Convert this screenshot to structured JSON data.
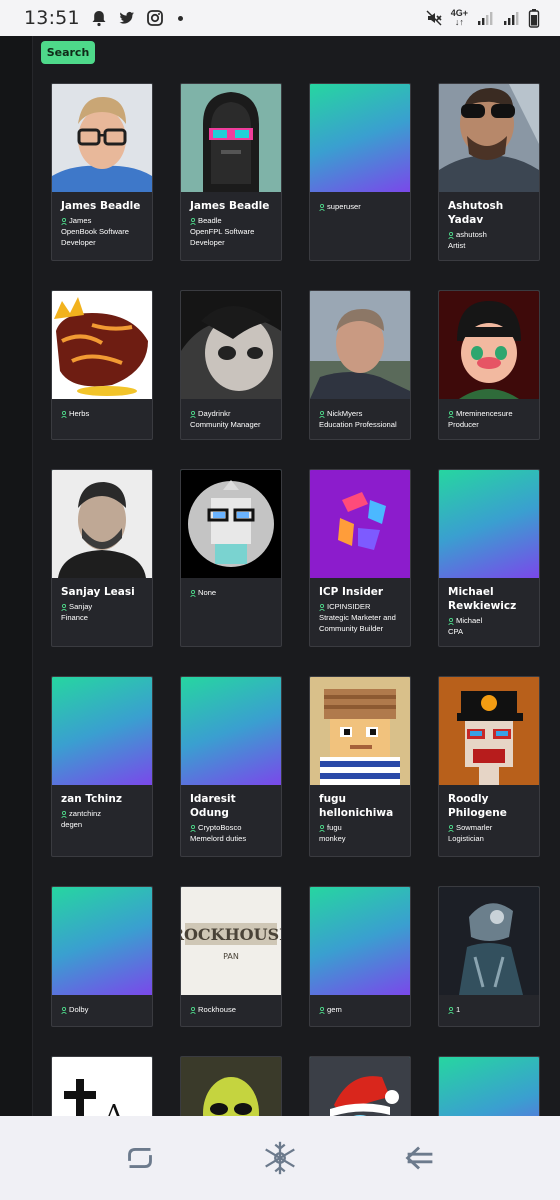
{
  "status_bar": {
    "time": "13:51",
    "icons": [
      "notification-bell-icon",
      "twitter-icon",
      "instagram-icon",
      "dot-icon",
      "mute-icon",
      "network-4g-icon",
      "signal-icon",
      "signal-icon",
      "battery-icon"
    ],
    "network": "4G+"
  },
  "search": {
    "label": "Search"
  },
  "cards": [
    {
      "name": "James Beadle",
      "handle": "James",
      "bio": "OpenBook Software Developer",
      "avatar": "photo-man-glasses"
    },
    {
      "name": "James Beadle",
      "handle": "Beadle",
      "bio": "OpenFPL Software Developer",
      "avatar": "pixel-hooded-figure"
    },
    {
      "name": "",
      "handle": "superuser",
      "bio": "",
      "avatar": "gradient"
    },
    {
      "name": "Ashutosh Yadav",
      "handle": "ashutosh",
      "bio": "Artist",
      "avatar": "photo-man-sunglasses"
    },
    {
      "name": "",
      "handle": "Herbs",
      "bio": "",
      "avatar": "lava-creature"
    },
    {
      "name": "",
      "handle": "Daydrinkr",
      "bio": "Community Manager",
      "avatar": "pixel-anime-face"
    },
    {
      "name": "",
      "handle": "NickMyers",
      "bio": "Education Professional",
      "avatar": "photo-man-suit"
    },
    {
      "name": "",
      "handle": "Mreminencesure",
      "bio": "Producer",
      "avatar": "cartoon-boy-beanie"
    },
    {
      "name": "Sanjay Leasi",
      "handle": "Sanjay",
      "bio": "Finance",
      "avatar": "photo-man-beard"
    },
    {
      "name": "",
      "handle": "None",
      "bio": "",
      "avatar": "pixel-robot-circle"
    },
    {
      "name": "ICP Insider",
      "handle": "ICPINSIDER",
      "bio": "Strategic Marketer and Community Builder",
      "avatar": "icp-logo"
    },
    {
      "name": "Michael Rewkiewicz",
      "handle": "Michael",
      "bio": "CPA",
      "avatar": "gradient"
    },
    {
      "name": "zan Tchinz",
      "handle": "zantchinz",
      "bio": "degen",
      "avatar": "gradient"
    },
    {
      "name": "Idaresit Odung",
      "handle": "CryptoBosco",
      "bio": "Memelord duties",
      "avatar": "gradient"
    },
    {
      "name": "fugu hellonichiwa",
      "handle": "fugu",
      "bio": "monkey",
      "avatar": "pixel-beanie-face"
    },
    {
      "name": "Roodly Philogene",
      "handle": "Sowmarler",
      "bio": "Logistician",
      "avatar": "pixel-bitcoin-cap"
    },
    {
      "name": "",
      "handle": "Dolby",
      "bio": "",
      "avatar": "gradient"
    },
    {
      "name": "",
      "handle": "Rockhouse",
      "bio": "",
      "avatar": "rockhouse-logo"
    },
    {
      "name": "",
      "handle": "gem",
      "bio": "",
      "avatar": "gradient"
    },
    {
      "name": "",
      "handle": "1",
      "bio": "",
      "avatar": "robot-art"
    },
    {
      "name": "",
      "handle": "",
      "bio": "",
      "avatar": "cross-logo"
    },
    {
      "name": "",
      "handle": "",
      "bio": "",
      "avatar": "alien-art"
    },
    {
      "name": "",
      "handle": "",
      "bio": "",
      "avatar": "santa-hat-art"
    },
    {
      "name": "",
      "handle": "",
      "bio": "",
      "avatar": "gradient"
    }
  ],
  "bottom_nav": [
    "recent-apps-icon",
    "snowflake-home-icon",
    "back-arrow-icon"
  ],
  "colors": {
    "accent": "#4ed98a",
    "background": "#1a1b1e",
    "card": "#25262b",
    "gradient": [
      "#26d6a0",
      "#3a9fd0",
      "#7a48ea"
    ]
  }
}
